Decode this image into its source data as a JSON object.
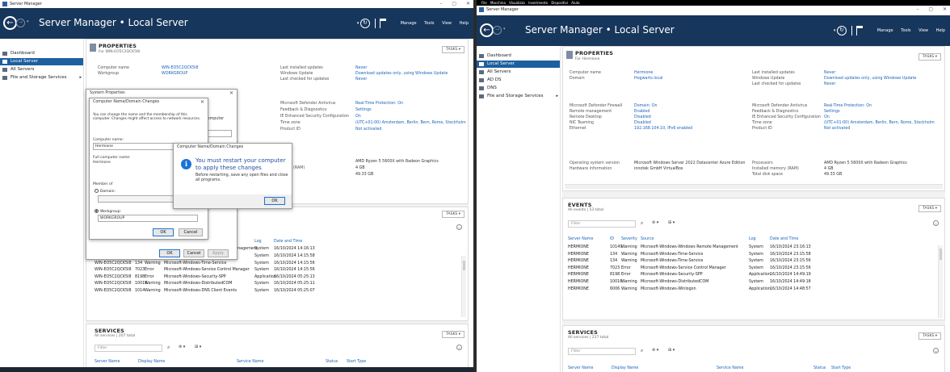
{
  "colors": {
    "header_bg": "#17365c",
    "nav_selected": "#1d5f9f",
    "link_blue": "#1a63b8"
  },
  "s1": {
    "title": "Server Manager",
    "header": {
      "breadcrumb": "Server Manager • Local Server",
      "menu": [
        "Manage",
        "Tools",
        "View",
        "Help"
      ]
    },
    "nav": [
      "Dashboard",
      "Local Server",
      "All Servers",
      "File and Storage Services"
    ],
    "properties": {
      "title": "PROPERTIES",
      "subtitle": "For WIN-EO5C2QCK5I8",
      "tasks": "TASKS",
      "computer_name_label": "Computer name",
      "computer_name": "WIN-EO5C2QCK5I8",
      "workgroup_label": "Workgroup",
      "workgroup": "WORKGROUP",
      "last_updates_label": "Last installed updates",
      "last_updates": "Never",
      "windows_update_label": "Windows Update",
      "windows_update": "Download updates only, using Windows Update",
      "last_checked_label": "Last checked for updates",
      "last_checked": "Never",
      "defender_label": "Microsoft Defender Antivirus",
      "defender": "Real-Time Protection: On",
      "feedback_label": "Feedback & Diagnostics",
      "feedback": "Settings",
      "ie_label": "IE Enhanced Security Configuration",
      "ie": "On",
      "tz_label": "Time zone",
      "tz": "(UTC+01:00) Amsterdam, Berlin, Bern, Rome, Stockholm",
      "pid_label": "Product ID",
      "pid": "Not activated",
      "cpu": "AMD Ryzen 5 5600X with Radeon Graphics",
      "mem_label": "mory (RAM)",
      "mem": "4 GB",
      "disk_label": "ace",
      "disk": "49.33 GB"
    },
    "events": {
      "tasks": "TASKS",
      "cols": [
        "Log",
        "Date and Time"
      ],
      "first_row": {
        "source": "Remote Management",
        "log": "System",
        "date": "16/10/2024 14:16:13"
      },
      "rows": [
        {
          "server": "WIN-EO5C2QCK5I8",
          "id": "134",
          "sev": "Warning",
          "source": "Microsoft-Windows-Time-Service",
          "log": "System",
          "date": "16/10/2024 14:15:58"
        },
        {
          "server": "WIN-EO5C2QCK5I8",
          "id": "134",
          "sev": "Warning",
          "source": "Microsoft-Windows-Time-Service",
          "log": "System",
          "date": "16/10/2024 14:15:56"
        },
        {
          "server": "WIN-EO5C2QCK5I8",
          "id": "7023",
          "sev": "Error",
          "source": "Microsoft-Windows-Service Control Manager",
          "log": "System",
          "date": "16/10/2024 14:15:56"
        },
        {
          "server": "WIN-EO5C2QCK5I8",
          "id": "8198",
          "sev": "Error",
          "source": "Microsoft-Windows-Security-SPP",
          "log": "Application",
          "date": "16/10/2024 05:25:13"
        },
        {
          "server": "WIN-EO5C2QCK5I8",
          "id": "10016",
          "sev": "Warning",
          "source": "Microsoft-Windows-DistributedCOM",
          "log": "System",
          "date": "16/10/2024 05:25:11"
        },
        {
          "server": "WIN-EO5C2QCK5I8",
          "id": "1014",
          "sev": "Warning",
          "source": "Microsoft-Windows-DNS Client Events",
          "log": "System",
          "date": "16/10/2024 05:25:07"
        }
      ]
    },
    "services": {
      "title": "SERVICES",
      "subtitle": "All services | 207 total",
      "tasks": "TASKS",
      "filter": "Filter",
      "cols": [
        "Server Name",
        "Display Name",
        "Service Name",
        "Status",
        "Start Type"
      ]
    },
    "sysprops": {
      "title": "System Properties",
      "ok": "OK",
      "cancel": "Cancel",
      "apply": "Apply"
    },
    "cnd": {
      "title": "Computer Name/Domain Changes",
      "desc": "You can change the name and the membership of this computer. Changes might affect access to network resources.",
      "computer_name_label": "Computer name:",
      "computer_name": "Hermione",
      "full_name_label": "Full computer name:",
      "full_name": "Hermione",
      "more": "More...",
      "member_of": "Member of",
      "domain": "Domain:",
      "workgroup": "Workgroup:",
      "workgroup_value": "WORKGROUP",
      "ok": "OK",
      "cancel": "Cancel",
      "behind_text": "computer"
    },
    "restart": {
      "title": "Computer Name/Domain Changes",
      "main": "You must restart your computer to apply these changes",
      "sub": "Before restarting, save any open files and close all programs.",
      "ok": "OK"
    }
  },
  "s2": {
    "vbox_menu": "File  Macchina  Visualizza  Inserimento  Dispositivi  Aiuto",
    "title": "Server Manager",
    "header": {
      "breadcrumb": "Server Manager • Local Server",
      "menu": [
        "Manage",
        "Tools",
        "View",
        "Help"
      ]
    },
    "nav": [
      "Dashboard",
      "Local Server",
      "All Servers",
      "AD DS",
      "DNS",
      "File and Storage Services"
    ],
    "properties": {
      "title": "PROPERTIES",
      "subtitle": "For Hermione",
      "tasks": "TASKS",
      "computer_name_label": "Computer name",
      "computer_name": "Hermione",
      "domain_label": "Domain",
      "domain": "Hogwarts.local",
      "last_updates_label": "Last installed updates",
      "last_updates": "Never",
      "windows_update_label": "Windows Update",
      "windows_update": "Download updates only, using Windows Update",
      "last_checked_label": "Last checked for updates",
      "last_checked": "Never",
      "firewall_label": "Microsoft Defender Firewall",
      "firewall": "Domain: On",
      "remote_mgmt_label": "Remote management",
      "remote_mgmt": "Enabled",
      "remote_desktop_label": "Remote Desktop",
      "remote_desktop": "Disabled",
      "nic_label": "NIC Teaming",
      "nic": "Disabled",
      "ethernet_label": "Ethernet",
      "ethernet": "192.168.104.10, IPv6 enabled",
      "defender_label": "Microsoft Defender Antivirus",
      "defender": "Real-Time Protection: On",
      "feedback_label": "Feedback & Diagnostics",
      "feedback": "Settings",
      "ie_label": "IE Enhanced Security Configuration",
      "ie": "On",
      "tz_label": "Time zone",
      "tz": "(UTC+01:00) Amsterdam, Berlin, Bern, Rome, Stockholm",
      "pid_label": "Product ID",
      "pid": "Not activated",
      "os_label": "Operating system version",
      "os": "Microsoft Windows Server 2022 Datacenter Azure Edition",
      "hw_label": "Hardware information",
      "hw": "innotek GmbH VirtualBox",
      "cpu_label": "Processors",
      "cpu": "AMD Ryzen 5 5600X with Radeon Graphics",
      "mem_label": "Installed memory (RAM)",
      "mem": "4 GB",
      "disk_label": "Total disk space",
      "disk": "49.33 GB"
    },
    "events": {
      "title": "EVENTS",
      "subtitle": "All events | 53 total",
      "tasks": "TASKS",
      "filter": "Filter",
      "cols": [
        "Server Name",
        "ID",
        "Severity",
        "Source",
        "Log",
        "Date and Time"
      ],
      "rows": [
        {
          "server": "HERMIONE",
          "id": "10149",
          "sev": "Warning",
          "source": "Microsoft-Windows-Windows Remote Management",
          "log": "System",
          "date": "16/10/2024 23:16:13"
        },
        {
          "server": "HERMIONE",
          "id": "134",
          "sev": "Warning",
          "source": "Microsoft-Windows-Time-Service",
          "log": "System",
          "date": "16/10/2024 23:15:58"
        },
        {
          "server": "HERMIONE",
          "id": "134",
          "sev": "Warning",
          "source": "Microsoft-Windows-Time-Service",
          "log": "System",
          "date": "16/10/2024 23:15:56"
        },
        {
          "server": "HERMIONE",
          "id": "7023",
          "sev": "Error",
          "source": "Microsoft-Windows-Service Control Manager",
          "log": "System",
          "date": "16/10/2024 23:15:56"
        },
        {
          "server": "HERMIONE",
          "id": "8198",
          "sev": "Error",
          "source": "Microsoft-Windows-Security-SPP",
          "log": "Application",
          "date": "16/10/2024 14:49:19"
        },
        {
          "server": "HERMIONE",
          "id": "10016",
          "sev": "Warning",
          "source": "Microsoft-Windows-DistributedCOM",
          "log": "System",
          "date": "16/10/2024 14:49:18"
        },
        {
          "server": "HERMIONE",
          "id": "6006",
          "sev": "Warning",
          "source": "Microsoft-Windows-Winlogon",
          "log": "Application",
          "date": "16/10/2024 14:48:57"
        }
      ]
    },
    "services": {
      "title": "SERVICES",
      "subtitle": "All services | 217 total",
      "tasks": "TASKS",
      "filter": "Filter",
      "cols": [
        "Server Name",
        "Display Name",
        "Service Name",
        "Status",
        "Start Type"
      ]
    }
  }
}
